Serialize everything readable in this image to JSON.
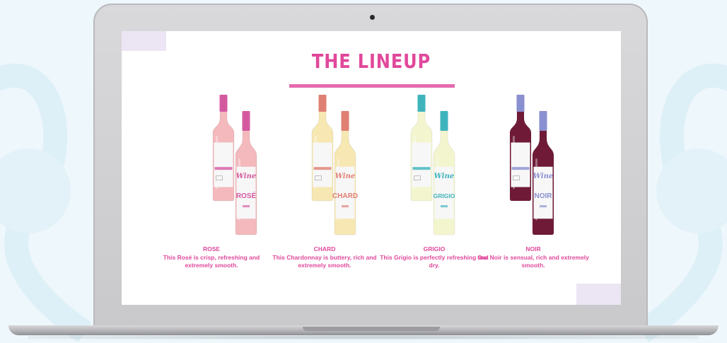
{
  "slide": {
    "title": "THE LINEUP",
    "accent_color": "#e0489b",
    "corner_color": "#ece5f3"
  },
  "wines": [
    {
      "name": "ROSE",
      "label": "ROSÉ",
      "brand": "Wine",
      "description": "This Rosé is crisp, refreshing and extremely smooth.",
      "wine_color": "#f3b9bd",
      "cap_color": "#d45aa0"
    },
    {
      "name": "CHARD",
      "label": "CHARD",
      "brand": "Wine",
      "description": "This Chardonnay is buttery, rich and extremely smooth.",
      "wine_color": "#f6e7b3",
      "cap_color": "#e07f73"
    },
    {
      "name": "GRIGIO",
      "label": "GRIGIO",
      "brand": "Wine",
      "description": "This Grigio is perfectly refreshing and dry.",
      "wine_color": "#f3f5cf",
      "cap_color": "#3fb4bd"
    },
    {
      "name": "NOIR",
      "label": "NOIR",
      "brand": "Wine",
      "description": "Our Noir is sensual, rich and extremely smooth.",
      "wine_color": "#6f1b38",
      "cap_color": "#8a8fd0"
    }
  ]
}
